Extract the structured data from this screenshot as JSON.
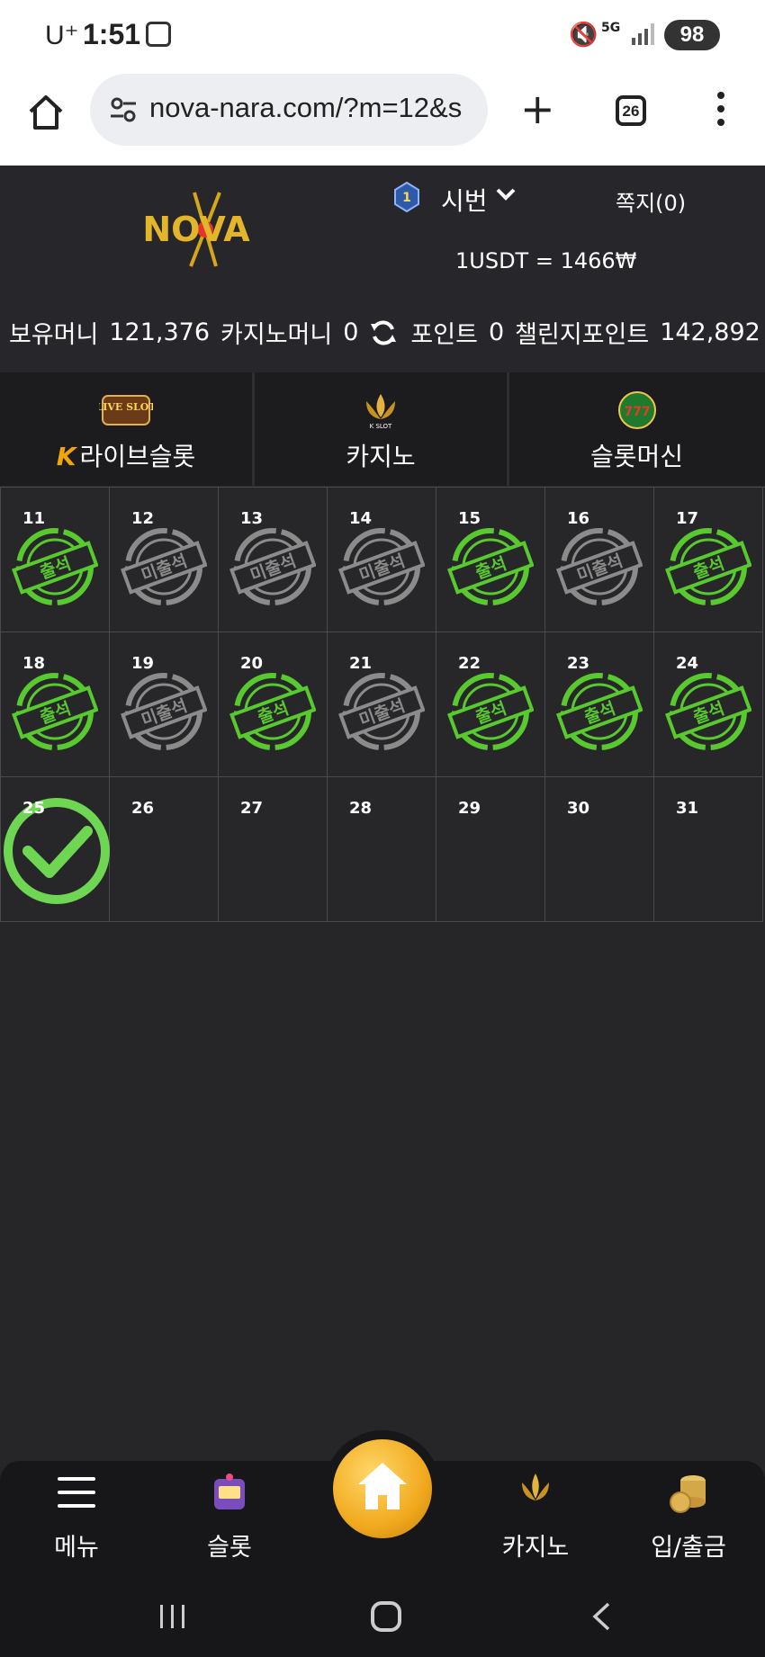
{
  "status_bar": {
    "carrier": "U⁺",
    "time": "1:51",
    "network": "5G",
    "battery": "98"
  },
  "browser": {
    "url": "nova-nara.com/?m=12&s",
    "tab_count": "26"
  },
  "header": {
    "logo_text": "NOVA",
    "tier_badge": "1",
    "tier_name": "시번",
    "message_label": "쪽지(0)",
    "exchange_rate": "1USDT = 1466₩",
    "balances": {
      "holding_money_label": "보유머니",
      "holding_money_value": "121,376",
      "casino_money_label": "카지노머니",
      "casino_money_value": "0",
      "point_label": "포인트",
      "point_value": "0",
      "challenge_point_label": "챌린지포인트",
      "challenge_point_value": "142,892"
    }
  },
  "category_tabs": [
    {
      "label": "라이브슬롯",
      "prefix": "K",
      "icon": "live-slot-icon",
      "icon_text": "LIVE SLOT"
    },
    {
      "label": "카지노",
      "icon": "k-slot-lotus-icon",
      "icon_text": "K SLOT"
    },
    {
      "label": "슬롯머신",
      "icon": "777-slots-icon",
      "icon_text": "777"
    }
  ],
  "attendance": {
    "present_label": "출석",
    "absent_label": "미출석",
    "colors": {
      "present": "#58c92e",
      "absent": "#8b8b8b",
      "check": "#6fd654"
    },
    "days": [
      {
        "day": "11",
        "status": "present"
      },
      {
        "day": "12",
        "status": "absent"
      },
      {
        "day": "13",
        "status": "absent"
      },
      {
        "day": "14",
        "status": "absent"
      },
      {
        "day": "15",
        "status": "present"
      },
      {
        "day": "16",
        "status": "absent"
      },
      {
        "day": "17",
        "status": "present"
      },
      {
        "day": "18",
        "status": "present"
      },
      {
        "day": "19",
        "status": "absent"
      },
      {
        "day": "20",
        "status": "present"
      },
      {
        "day": "21",
        "status": "absent"
      },
      {
        "day": "22",
        "status": "present"
      },
      {
        "day": "23",
        "status": "present"
      },
      {
        "day": "24",
        "status": "present"
      },
      {
        "day": "25",
        "status": "today_checked"
      },
      {
        "day": "26",
        "status": "none"
      },
      {
        "day": "27",
        "status": "none"
      },
      {
        "day": "28",
        "status": "none"
      },
      {
        "day": "29",
        "status": "none"
      },
      {
        "day": "30",
        "status": "none"
      },
      {
        "day": "31",
        "status": "none"
      }
    ]
  },
  "bottom_nav": {
    "menu": "메뉴",
    "slot": "슬롯",
    "casino": "카지노",
    "deposit_withdraw": "입/출금"
  }
}
